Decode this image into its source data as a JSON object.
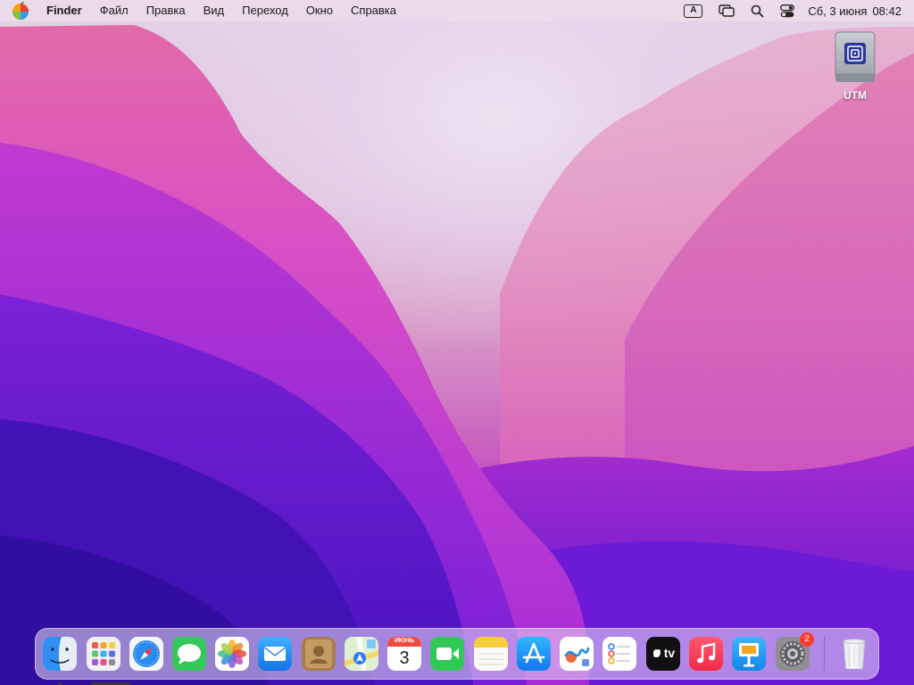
{
  "menubar": {
    "app_name": "Finder",
    "menus": [
      "Файл",
      "Правка",
      "Вид",
      "Переход",
      "Окно",
      "Справка"
    ],
    "keyboard_layout": "A",
    "date": "Сб, 3 июня",
    "time": "08:42",
    "status_icons": [
      "keyboard-layout-icon",
      "display-mirroring-icon",
      "spotlight-search-icon",
      "control-center-icon"
    ]
  },
  "desktop": {
    "icons": [
      {
        "label": "UTM",
        "icon": "external-drive-icon"
      }
    ]
  },
  "dock": {
    "apps": [
      {
        "name": "Finder",
        "icon": "finder-icon",
        "running": true
      },
      {
        "name": "Launchpad",
        "icon": "launchpad-icon"
      },
      {
        "name": "Safari",
        "icon": "safari-icon"
      },
      {
        "name": "Messages",
        "icon": "messages-icon"
      },
      {
        "name": "Photos",
        "icon": "photos-icon"
      },
      {
        "name": "Mail",
        "icon": "mail-icon"
      },
      {
        "name": "Contacts",
        "icon": "contacts-icon"
      },
      {
        "name": "Maps",
        "icon": "maps-icon"
      },
      {
        "name": "Calendar",
        "icon": "calendar-icon",
        "month": "ИЮНЬ",
        "day": "3"
      },
      {
        "name": "FaceTime",
        "icon": "facetime-icon"
      },
      {
        "name": "Notes",
        "icon": "notes-icon"
      },
      {
        "name": "App Store",
        "icon": "app-store-icon"
      },
      {
        "name": "Freeform",
        "icon": "freeform-icon"
      },
      {
        "name": "Reminders",
        "icon": "reminders-icon"
      },
      {
        "name": "TV",
        "icon": "apple-tv-icon",
        "text": "tv"
      },
      {
        "name": "Music",
        "icon": "music-icon"
      },
      {
        "name": "Keynote",
        "icon": "keynote-icon"
      },
      {
        "name": "System Settings",
        "icon": "system-settings-icon",
        "badge": "2"
      }
    ],
    "trash": {
      "name": "Trash",
      "icon": "trash-icon"
    }
  }
}
